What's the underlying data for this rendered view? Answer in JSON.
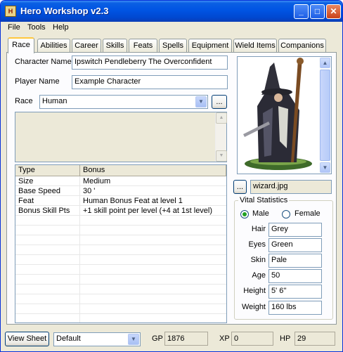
{
  "window": {
    "title": "Hero Workshop v2.3",
    "icon": "app-scroll-icon"
  },
  "menu": [
    "File",
    "Tools",
    "Help"
  ],
  "tabs": [
    "Race",
    "Abilities",
    "Career",
    "Skills",
    "Feats",
    "Spells",
    "Equipment",
    "Wield Items",
    "Companions"
  ],
  "active_tab": "Race",
  "form": {
    "character_name_label": "Character Name",
    "character_name": "Ipswitch Pendleberry The Overconfident",
    "player_name_label": "Player Name",
    "player_name": "Example Character",
    "race_label": "Race",
    "race": "Human",
    "browse_label": "..."
  },
  "grid": {
    "columns": [
      "Type",
      "Bonus"
    ],
    "rows": [
      [
        "Size",
        "Medium"
      ],
      [
        "Base Speed",
        "30 '"
      ],
      [
        "Feat",
        "Human Bonus Feat at level 1"
      ],
      [
        "Bonus Skill Pts",
        "+1 skill point per level (+4 at 1st level)"
      ]
    ]
  },
  "portrait": {
    "browse_label": "...",
    "filename": "wizard.jpg"
  },
  "vitals": {
    "legend": "Vital Statistics",
    "male_label": "Male",
    "female_label": "Female",
    "gender": "Male",
    "fields": [
      {
        "label": "Hair",
        "value": "Grey"
      },
      {
        "label": "Eyes",
        "value": "Green"
      },
      {
        "label": "Skin",
        "value": "Pale"
      },
      {
        "label": "Age",
        "value": "50"
      },
      {
        "label": "Height",
        "value": "5' 6''"
      },
      {
        "label": "Weight",
        "value": "160 lbs"
      }
    ]
  },
  "status": {
    "view_sheet_label": "View Sheet",
    "sheet_select": "Default",
    "gp_label": "GP",
    "gp": "1876",
    "xp_label": "XP",
    "xp": "0",
    "hp_label": "HP",
    "hp": "29"
  },
  "colors": {
    "titlebar": "#0054e3",
    "active_tab_accent": "#ffc83c",
    "face": "#ece9d8"
  }
}
